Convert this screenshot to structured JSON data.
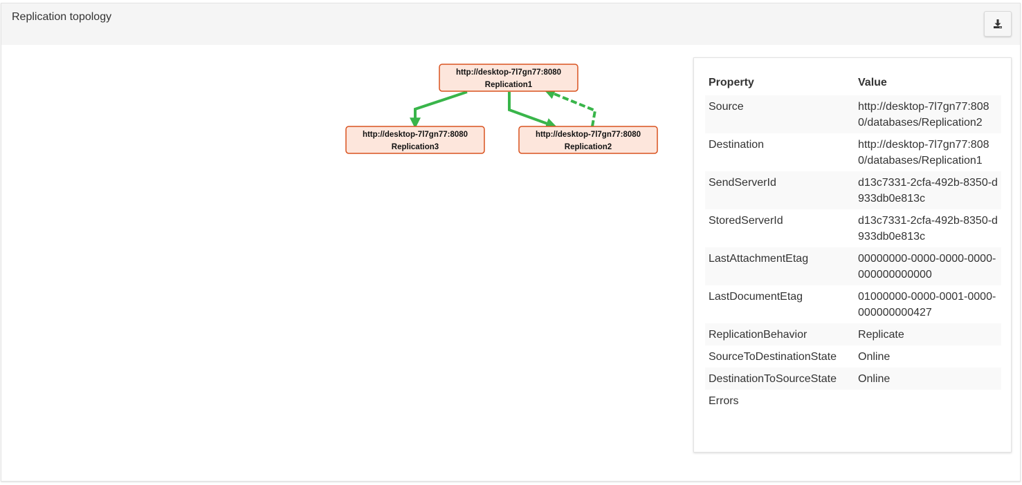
{
  "panel": {
    "title": "Replication topology",
    "download_icon": "download-icon"
  },
  "colors": {
    "node_fill": "#fde6dc",
    "node_border": "#d9521f",
    "edge": "#39b54a",
    "header_bg": "#f5f5f5"
  },
  "graph": {
    "nodes": [
      {
        "url": "http://desktop-7l7gn77:8080",
        "name": "Replication1"
      },
      {
        "url": "http://desktop-7l7gn77:8080",
        "name": "Replication3"
      },
      {
        "url": "http://desktop-7l7gn77:8080",
        "name": "Replication2"
      }
    ],
    "edges": [
      {
        "from": "Replication1",
        "to": "Replication3",
        "style": "solid"
      },
      {
        "from": "Replication1",
        "to": "Replication2",
        "style": "solid"
      },
      {
        "from": "Replication2",
        "to": "Replication1",
        "style": "dashed"
      }
    ]
  },
  "properties": {
    "header_property": "Property",
    "header_value": "Value",
    "rows": [
      {
        "key": "Source",
        "value": "http://desktop-7l7gn77:8080/databases/Replication2"
      },
      {
        "key": "Destination",
        "value": "http://desktop-7l7gn77:8080/databases/Replication1"
      },
      {
        "key": "SendServerId",
        "value": "d13c7331-2cfa-492b-8350-d933db0e813c"
      },
      {
        "key": "StoredServerId",
        "value": "d13c7331-2cfa-492b-8350-d933db0e813c"
      },
      {
        "key": "LastAttachmentEtag",
        "value": "00000000-0000-0000-0000-000000000000"
      },
      {
        "key": "LastDocumentEtag",
        "value": "01000000-0000-0001-0000-000000000427"
      },
      {
        "key": "ReplicationBehavior",
        "value": "Replicate"
      },
      {
        "key": "SourceToDestinationState",
        "value": "Online"
      },
      {
        "key": "DestinationToSourceState",
        "value": "Online"
      },
      {
        "key": "Errors",
        "value": ""
      }
    ]
  }
}
